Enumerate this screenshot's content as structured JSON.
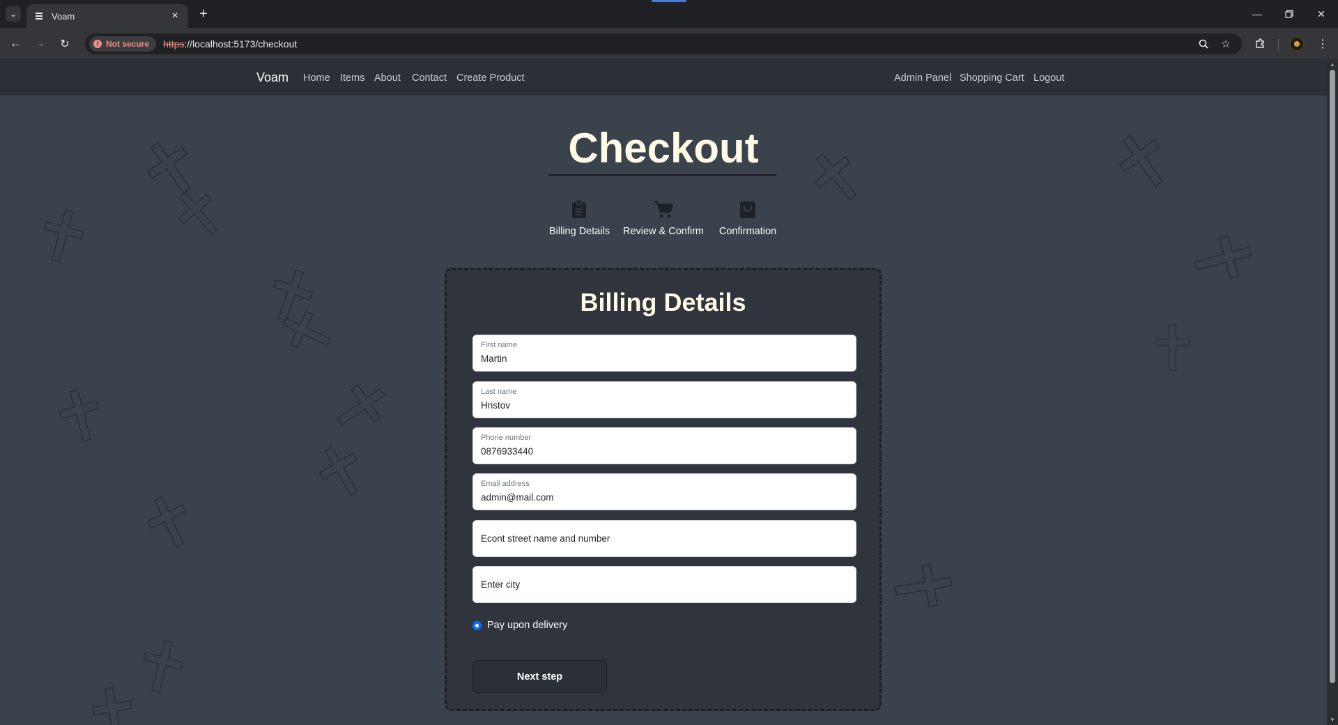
{
  "browser": {
    "tab_title": "Voam",
    "url_scheme": "https",
    "url_rest": "://localhost:5173/checkout",
    "security_label": "Not secure"
  },
  "navbar": {
    "brand": "Voam",
    "left_links": [
      "Home",
      "Items",
      "About",
      "Contact",
      "Create Product"
    ],
    "right_links": [
      "Admin Panel",
      "Shopping Cart",
      "Logout"
    ]
  },
  "page": {
    "title": "Checkout",
    "steps": [
      {
        "label": "Billing Details",
        "icon": "clipboard-icon"
      },
      {
        "label": "Review & Confirm",
        "icon": "cart-icon"
      },
      {
        "label": "Confirmation",
        "icon": "bag-icon"
      }
    ]
  },
  "form": {
    "title": "Billing Details",
    "fields": [
      {
        "label": "First name",
        "value": "Martin"
      },
      {
        "label": "Last name",
        "value": "Hristov"
      },
      {
        "label": "Phone number",
        "value": "0876933440"
      },
      {
        "label": "Email address",
        "value": "admin@mail.com"
      },
      {
        "placeholder": "Econt street name and number"
      },
      {
        "placeholder": "Enter city"
      }
    ],
    "payment_option": "Pay upon delivery",
    "next_button": "Next step"
  },
  "colors": {
    "page_bg": "#3a424c",
    "navbar_bg": "#2b3036",
    "heading": "#fffbe6",
    "radio_accent": "#0d6efd"
  }
}
